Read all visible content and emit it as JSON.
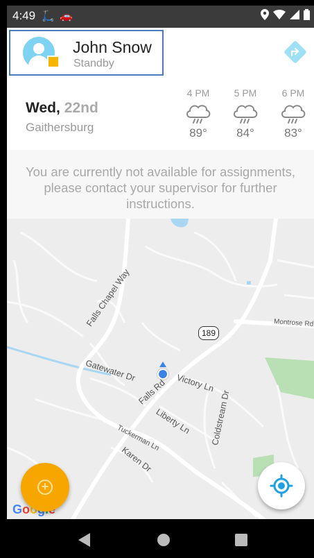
{
  "status_bar": {
    "time": "4:49",
    "left_icons": [
      "scooter-icon",
      "car-icon"
    ],
    "right_icons": [
      "location-pin-icon",
      "wifi-icon",
      "signal-icon",
      "battery-icon"
    ]
  },
  "profile": {
    "name": "John Snow",
    "status": "Standby",
    "status_color": "#f7b500"
  },
  "weather": {
    "day": "Wed,",
    "date": "22nd",
    "city": "Gaithersburg",
    "forecast": [
      {
        "time": "4 PM",
        "icon": "rain-cloud-icon",
        "temp": "89°"
      },
      {
        "time": "5 PM",
        "icon": "rain-cloud-icon",
        "temp": "84°"
      },
      {
        "time": "6 PM",
        "icon": "rain-cloud-icon",
        "temp": "83°"
      }
    ]
  },
  "notice": {
    "line1": "You are currently not available for assignments,",
    "line2": "please contact your supervisor for further",
    "line3": "instructions."
  },
  "map": {
    "streets": {
      "falls_chapel_way": "Falls Chapel Way",
      "gatewater_dr": "Gatewater Dr",
      "falls_rd": "Falls Rd",
      "victory_ln": "Victory Ln",
      "liberty_ln": "Liberty Ln",
      "coldstream_dr": "Coldstream Dr",
      "tuckerman_ln": "Tuckerman Ln",
      "karen_dr": "Karen Dr",
      "montrose_rd": "Montrose Rd"
    },
    "route_number": "189",
    "attribution": "Google"
  },
  "actions": {
    "add_icon": "plus-circle-icon",
    "locate_icon": "my-location-icon"
  },
  "colors": {
    "accent": "#f7a600",
    "nav_icon": "#9fe0f5",
    "location_blue": "#3b82e6"
  }
}
